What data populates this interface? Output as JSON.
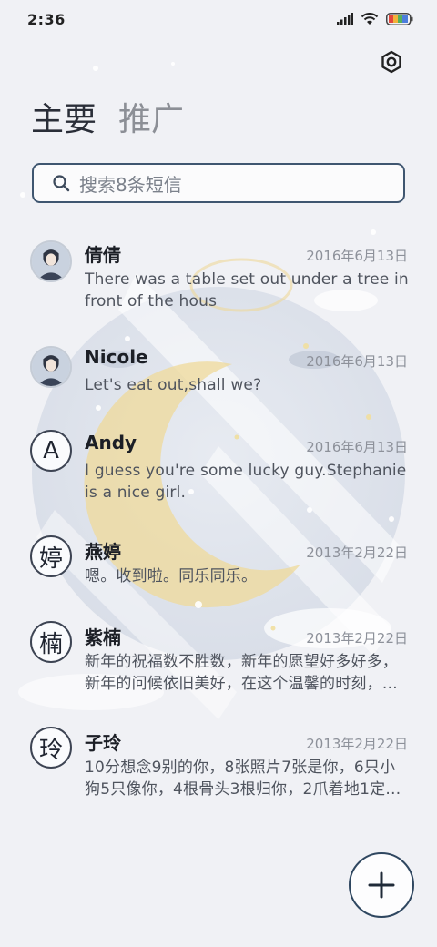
{
  "status_bar": {
    "time": "2:36",
    "icons": [
      "signal-icon",
      "wifi-icon",
      "battery-icon"
    ]
  },
  "header": {
    "settings_icon": "gear-icon",
    "tabs": [
      {
        "label": "主要",
        "active": true
      },
      {
        "label": "推广",
        "active": false
      }
    ]
  },
  "search": {
    "placeholder": "搜索8条短信"
  },
  "messages": [
    {
      "avatar_type": "photo",
      "avatar_text": "",
      "name": "倩倩",
      "date": "2016年6月13日",
      "preview": "There was a table set out under a tree in front of the hous"
    },
    {
      "avatar_type": "photo",
      "avatar_text": "",
      "name": "Nicole",
      "date": "2016年6月13日",
      "preview": "Let's eat out,shall we?"
    },
    {
      "avatar_type": "letter",
      "avatar_text": "A",
      "name": "Andy",
      "date": "2016年6月13日",
      "preview": "I guess you're some lucky guy.Stephanie is a nice girl."
    },
    {
      "avatar_type": "letter",
      "avatar_text": "婷",
      "name": "燕婷",
      "date": "2013年2月22日",
      "preview": "嗯。收到啦。同乐同乐。"
    },
    {
      "avatar_type": "letter",
      "avatar_text": "楠",
      "name": "紫楠",
      "date": "2013年2月22日",
      "preview": "新年的祝福数不胜数，新年的愿望好多好多，新年的问候依旧美好，在这个温馨的时刻，…"
    },
    {
      "avatar_type": "letter",
      "avatar_text": "玲",
      "name": "子玲",
      "date": "2013年2月22日",
      "preview": "10分想念9别的你，8张照片7张是你，6只小狗5只像你，4根骨头3根归你，2爪着地1定…"
    }
  ],
  "fab": {
    "icon": "plus-icon"
  },
  "colors": {
    "background": "#f0f1f5",
    "accent": "#3f5670",
    "moon": "#efd99a"
  }
}
